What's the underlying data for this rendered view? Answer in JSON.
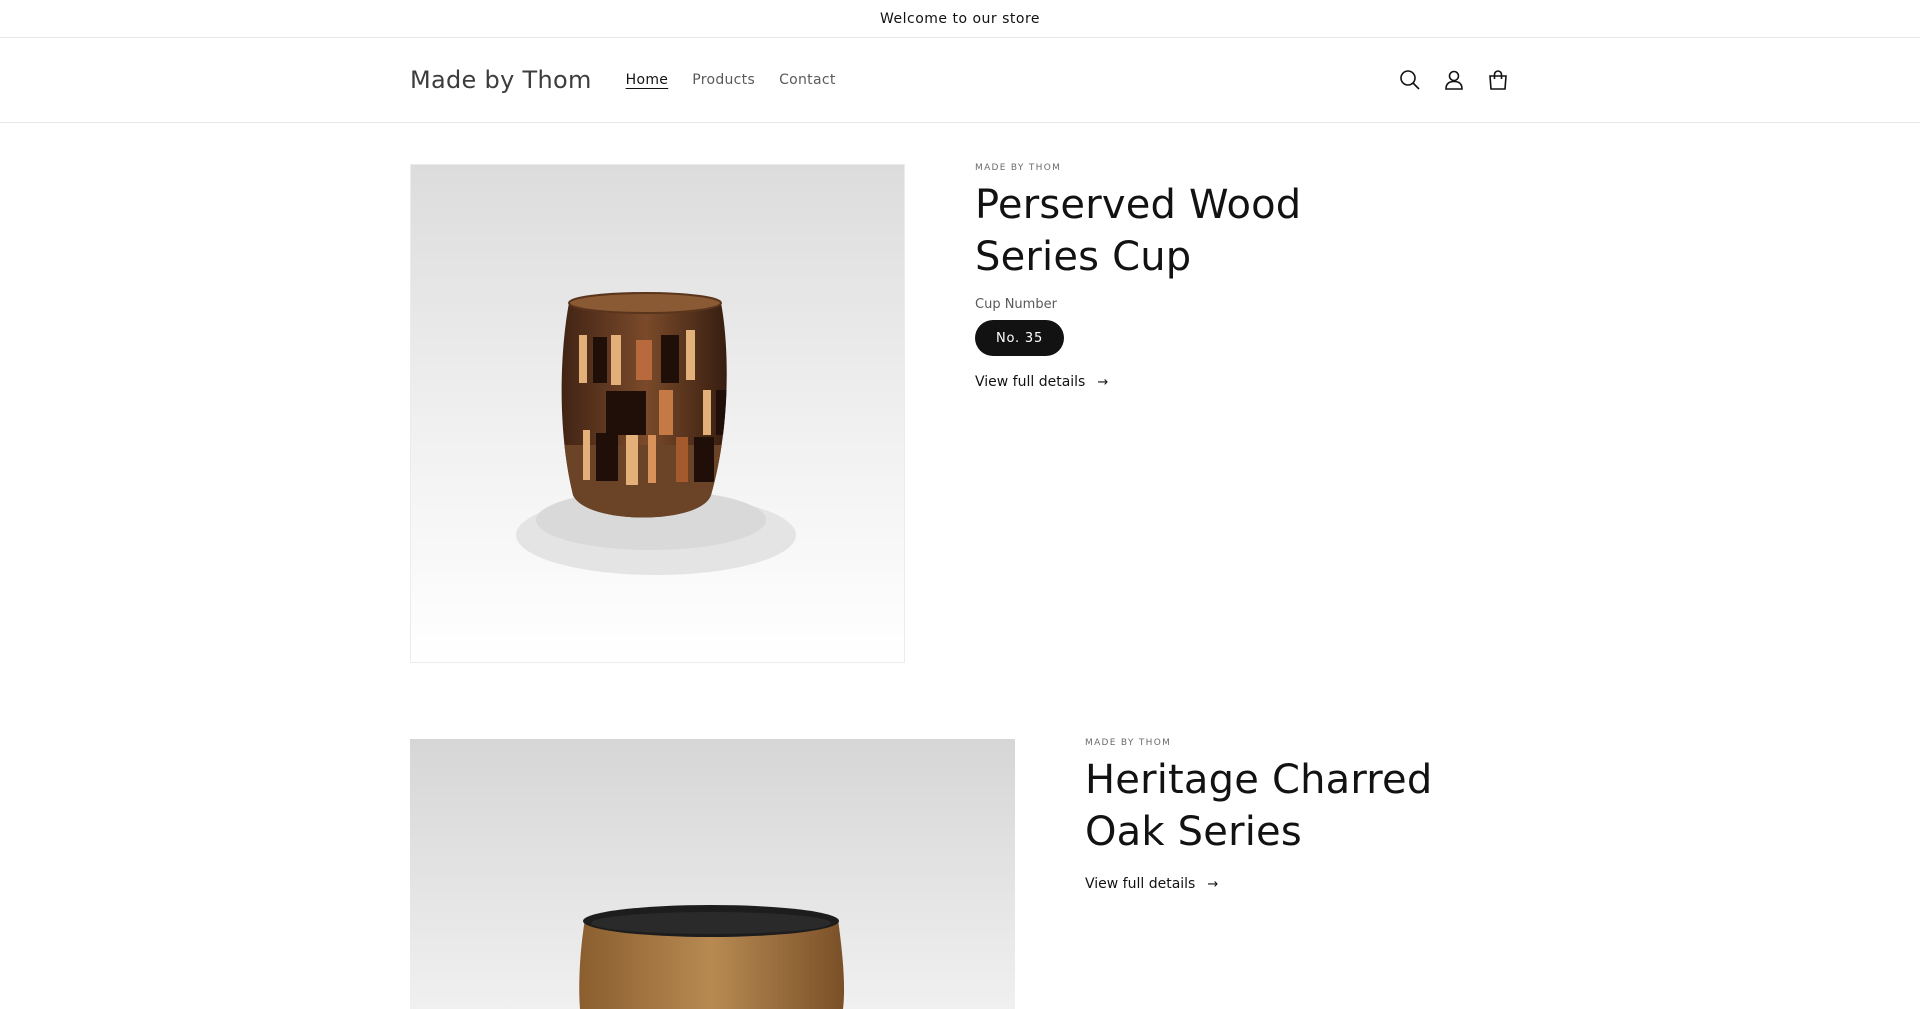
{
  "announcement": {
    "text": "Welcome to our store"
  },
  "header": {
    "logo": "Made by Thom",
    "nav": [
      {
        "label": "Home",
        "active": true
      },
      {
        "label": "Products",
        "active": false
      },
      {
        "label": "Contact",
        "active": false
      }
    ],
    "icons": [
      "search-icon",
      "account-icon",
      "cart-icon"
    ]
  },
  "products": [
    {
      "vendor": "MADE BY THOM",
      "title": "Perserved Wood Series Cup",
      "option_label": "Cup Number",
      "option_value": "No. 35",
      "details_link": "View full details"
    },
    {
      "vendor": "MADE BY THOM",
      "title": "Heritage Charred Oak Series",
      "details_link": "View full details"
    }
  ],
  "colors": {
    "text": "#121212",
    "muted": "#5a5a5a",
    "pill_bg": "#121212",
    "border": "#e6e6e6"
  }
}
